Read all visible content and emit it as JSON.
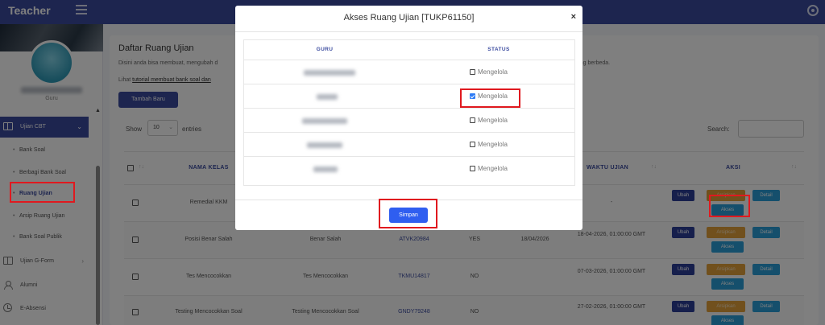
{
  "app": {
    "brand": "Teacher"
  },
  "sidebar": {
    "user_role": "Guru",
    "main_item": "Ujian CBT",
    "sub_items": [
      "Bank Soal",
      "Berbagi Bank Soal",
      "Ruang Ujian",
      "Arsip Ruang Ujian",
      "Bank Soal Publik"
    ],
    "other_items": [
      "Ujian G-Form",
      "Alumni",
      "E-Absensi"
    ]
  },
  "page": {
    "title": "Daftar Ruang Ujian",
    "description_left": "Disini anda bisa membuat, mengubah d",
    "description_right": "as yang berbeda.",
    "link_prefix": "Lihat ",
    "link_text": "tutorial membuat bank soal dan",
    "add_button": "Tambah Baru",
    "show_label": "Show",
    "show_value": "10",
    "entries_label": "entries",
    "search_label": "Search:"
  },
  "table": {
    "headers": {
      "kelas": "NAMA KELAS",
      "waktu": "WAKTU UJIAN",
      "aksi": "AKSI"
    },
    "sort_glyph": "↑↓",
    "rows": [
      {
        "kelas": "Remedial KKM",
        "bank": "",
        "kode": "",
        "acak": "",
        "tanggal": "",
        "waktu": "-"
      },
      {
        "kelas": "Posisi Benar Salah",
        "bank": "Benar Salah",
        "kode": "ATVK20984",
        "acak": "YES",
        "tanggal": "18/04/2026",
        "waktu": "18-04-2026, 01:00:00 GMT"
      },
      {
        "kelas": "Tes Mencocokkan",
        "bank": "Tes Mencocokkan",
        "kode": "TKMU14817",
        "acak": "NO",
        "tanggal": "",
        "waktu": "07-03-2026, 01:00:00 GMT"
      },
      {
        "kelas": "Testing Mencocokkan Soal",
        "bank": "Testing Mencocokkan Soal",
        "kode": "GNDY79248",
        "acak": "NO",
        "tanggal": "",
        "waktu": "27-02-2026, 01:00:00 GMT"
      }
    ],
    "actions": {
      "ubah": "Ubah",
      "arsip": "Arsipkan",
      "detail": "Detail",
      "akses": "Akses"
    }
  },
  "modal": {
    "title": "Akses Ruang Ujian [TUKP61150]",
    "close": "×",
    "col_guru": "GURU",
    "col_status": "STATUS",
    "rows": [
      {
        "status_label": "Mengelola",
        "checked": false
      },
      {
        "status_label": "Mengelola",
        "checked": true
      },
      {
        "status_label": "Mengelola",
        "checked": false
      },
      {
        "status_label": "Mengelola",
        "checked": false
      },
      {
        "status_label": "Mengelola",
        "checked": false
      }
    ],
    "save_button": "Simpan"
  },
  "colors": {
    "primary": "#3b4b9f",
    "highlight": "#e0191f",
    "save": "#2f5ef0"
  }
}
